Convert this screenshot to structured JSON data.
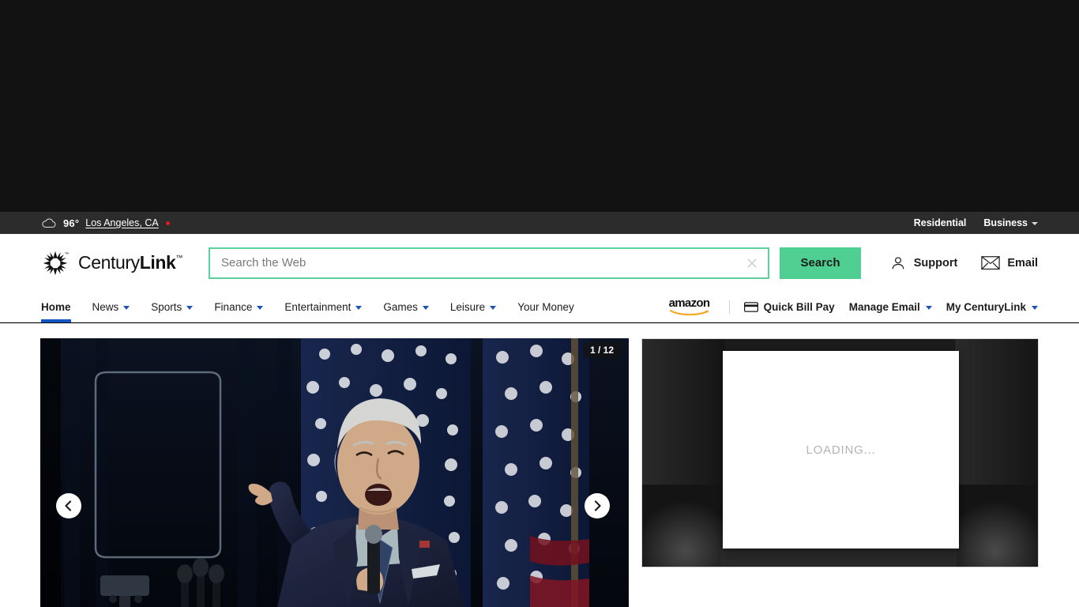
{
  "utility_bar": {
    "weather_icon": "cloud-icon",
    "temperature": "96°",
    "location": "Los Angeles, CA",
    "residential_label": "Residential",
    "business_label": "Business"
  },
  "header": {
    "brand_part1": "Century",
    "brand_part2": "Link",
    "brand_tm": "™",
    "logo_icon": "centurylink-starburst-icon",
    "search": {
      "placeholder": "Search the Web",
      "value": "",
      "clear_icon": "close-icon",
      "button_label": "Search"
    },
    "support_label": "Support",
    "support_icon": "person-icon",
    "email_label": "Email",
    "email_icon": "envelope-icon"
  },
  "nav": {
    "items": [
      {
        "label": "Home",
        "has_dropdown": false,
        "active": true
      },
      {
        "label": "News",
        "has_dropdown": true,
        "active": false
      },
      {
        "label": "Sports",
        "has_dropdown": true,
        "active": false
      },
      {
        "label": "Finance",
        "has_dropdown": true,
        "active": false
      },
      {
        "label": "Entertainment",
        "has_dropdown": true,
        "active": false
      },
      {
        "label": "Games",
        "has_dropdown": true,
        "active": false
      },
      {
        "label": "Leisure",
        "has_dropdown": true,
        "active": false
      },
      {
        "label": "Your Money",
        "has_dropdown": false,
        "active": false
      }
    ],
    "amazon_label": "amazon",
    "quick_bill_pay": "Quick Bill Pay",
    "quick_bill_pay_icon": "credit-card-icon",
    "manage_email": "Manage Email",
    "my_centurylink": "My CenturyLink"
  },
  "hero": {
    "counter": "1 / 12",
    "prev_icon": "chevron-left-icon",
    "next_icon": "chevron-right-icon",
    "image_alt": "Politician speaking into a microphone at a podium with American flags behind"
  },
  "ad": {
    "loading_text": "LOADING...",
    "colors": {
      "panel_bg": "#1c1c1c",
      "card_bg": "#ffffff"
    }
  },
  "colors": {
    "accent_green": "#4fcf91",
    "accent_blue": "#1256c4",
    "bar_dark": "#2c2c2c",
    "alert_red": "#e01b24"
  }
}
